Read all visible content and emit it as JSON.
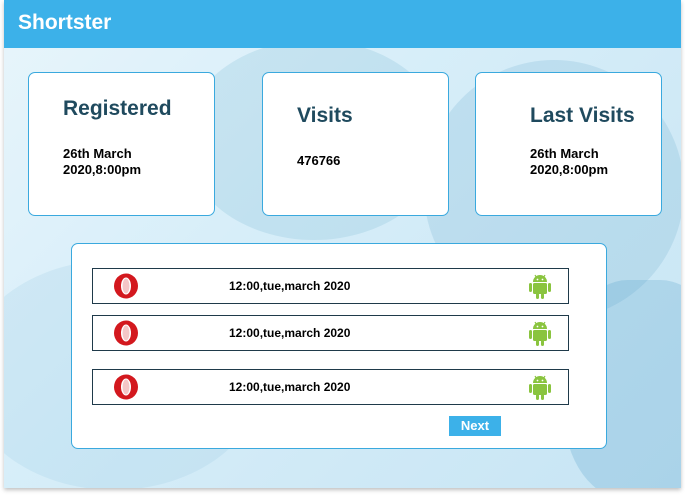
{
  "app": {
    "title": "Shortster"
  },
  "stats": {
    "registered": {
      "title": "Registered",
      "value_line1": "26th March",
      "value_line2": "2020,8:00pm"
    },
    "visits": {
      "title": "Visits",
      "value": "476766"
    },
    "last_visits": {
      "title": "Last Visits",
      "value_line1": "26th March",
      "value_line2": "2020,8:00pm"
    }
  },
  "visit_log": {
    "rows": [
      {
        "browser_icon": "opera-icon",
        "time": "12:00,tue,march 2020",
        "os_icon": "android-icon"
      },
      {
        "browser_icon": "opera-icon",
        "time": "12:00,tue,march 2020",
        "os_icon": "android-icon"
      },
      {
        "browser_icon": "opera-icon",
        "time": "12:00,tue,march 2020",
        "os_icon": "android-icon"
      }
    ],
    "next_label": "Next"
  },
  "colors": {
    "accent": "#3cb1e9",
    "title_text": "#1f4a5e",
    "opera_red": "#d3181e",
    "android_green": "#8ac43f"
  }
}
